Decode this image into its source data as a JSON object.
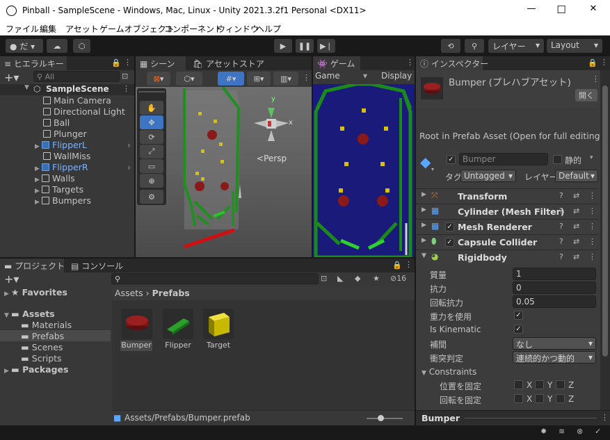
{
  "window": {
    "title": "Pinball - SampleScene - Windows, Mac, Linux - Unity 2021.3.2f1 Personal <DX11>",
    "minimize": "—",
    "maximize": "☐",
    "close": "✕"
  },
  "menu": [
    "ファイル",
    "編集",
    "アセット",
    "ゲームオブジェクト",
    "コンポーネント",
    "ウィンドウ",
    "ヘルプ"
  ],
  "toolbar": {
    "account": "だ ▾",
    "layers": "レイヤー",
    "layout": "Layout"
  },
  "hierarchy": {
    "tab": "ヒエラルキー",
    "search_placeholder": "All",
    "scene": "SampleScene",
    "items": [
      {
        "label": "Main Camera",
        "prefab": false
      },
      {
        "label": "Directional Light",
        "prefab": false
      },
      {
        "label": "Ball",
        "prefab": false
      },
      {
        "label": "Plunger",
        "prefab": false
      },
      {
        "label": "FlipperL",
        "prefab": true
      },
      {
        "label": "WallMiss",
        "prefab": false
      },
      {
        "label": "FlipperR",
        "prefab": true
      },
      {
        "label": "Walls",
        "prefab": false
      },
      {
        "label": "Targets",
        "prefab": false
      },
      {
        "label": "Bumpers",
        "prefab": false
      }
    ]
  },
  "scene": {
    "tab": "シーン",
    "assetstore_tab": "アセットストア",
    "persp": "Persp",
    "gizmo_y": "y",
    "gizmo_x": "x"
  },
  "game": {
    "tab": "ゲーム",
    "display_mode": "Game",
    "display": "Display"
  },
  "project": {
    "tab": "プロジェクト",
    "console_tab": "コンソール",
    "hidden_count": "16",
    "favorites": "Favorites",
    "assets": "Assets",
    "folders": [
      "Materials",
      "Prefabs",
      "Scenes",
      "Scripts"
    ],
    "packages": "Packages",
    "breadcrumb_root": "Assets",
    "breadcrumb_current": "Prefabs",
    "files": [
      "Bumper",
      "Flipper",
      "Target"
    ],
    "status_path": "Assets/Prefabs/Bumper.prefab"
  },
  "inspector": {
    "tab": "インスペクター",
    "title": "Bumper (プレハブアセット)",
    "open_button": "開く",
    "root_info": "Root in Prefab Asset (Open for full editing su",
    "name": "Bumper",
    "static": "静的",
    "tag_label": "タグ",
    "tag_value": "Untagged",
    "layer_label": "レイヤー",
    "layer_value": "Default",
    "components": [
      "Transform",
      "Cylinder (Mesh Filter)",
      "Mesh Renderer",
      "Capsule Collider",
      "Rigidbody"
    ],
    "rigidbody": {
      "mass_label": "質量",
      "mass": "1",
      "drag_label": "抗力",
      "drag": "0",
      "angular_drag_label": "回転抗力",
      "angular_drag": "0.05",
      "use_gravity_label": "重力を使用",
      "kinematic_label": "Is Kinematic",
      "interpolate_label": "補間",
      "interpolate": "なし",
      "collision_label": "衝突判定",
      "collision": "連続的かつ動的",
      "constraints_label": "Constraints",
      "freeze_pos_label": "位置を固定",
      "freeze_rot_label": "回転を固定",
      "x": "X",
      "y": "Y",
      "z": "Z"
    },
    "preview_label": "Bumper"
  },
  "colors": {
    "accent": "#3d74c4",
    "bumper": "#8a1a1a",
    "target": "#d6c000",
    "flipper": "#20a020",
    "game_bg": "#1a1a80"
  }
}
